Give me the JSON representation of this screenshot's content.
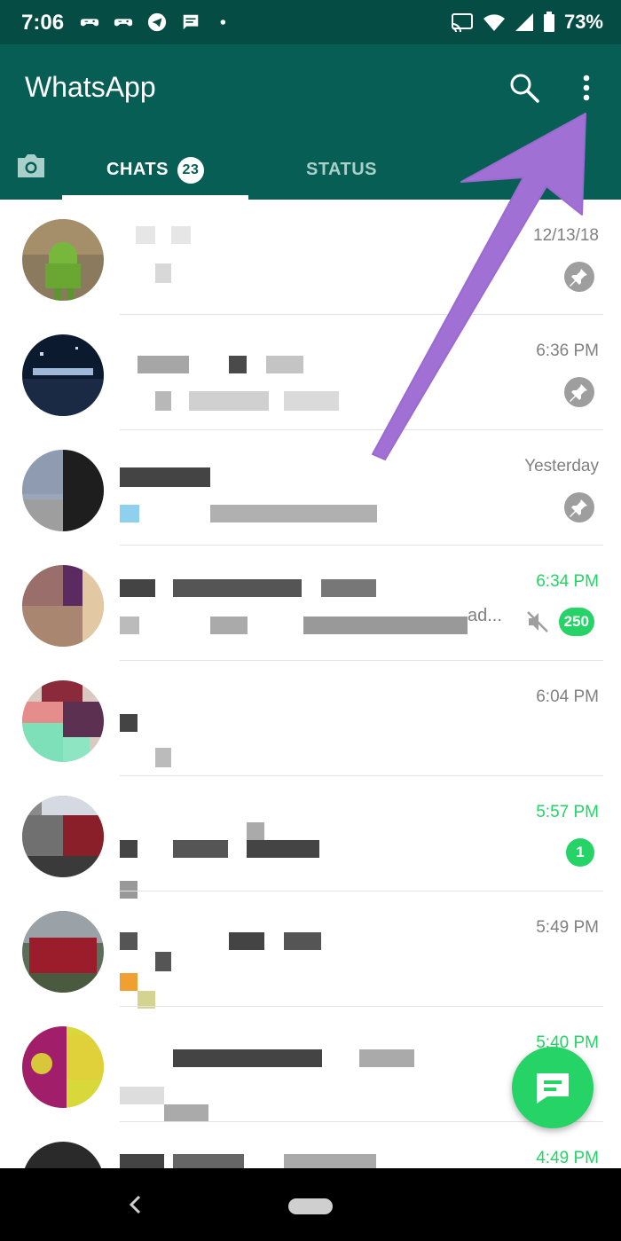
{
  "status_bar": {
    "time": "7:06",
    "battery": "73%",
    "notification_icons": [
      "gamepad-icon",
      "gamepad-icon",
      "telegram-icon",
      "message-icon",
      "dot-icon"
    ],
    "system_icons": [
      "cast-icon",
      "wifi-icon",
      "signal-icon",
      "battery-icon"
    ]
  },
  "app_bar": {
    "title": "WhatsApp",
    "search_icon": "search-icon",
    "more_icon": "more-vert-icon"
  },
  "tabs": {
    "camera_icon": "camera-icon",
    "chats_label": "CHATS",
    "chats_badge": "23",
    "status_label": "STATUS",
    "selected": "CHATS"
  },
  "chats": [
    {
      "time": "12/13/18",
      "pinned": true
    },
    {
      "time": "6:36 PM",
      "pinned": true
    },
    {
      "time": "Yesterday",
      "pinned": true
    },
    {
      "time": "6:34 PM",
      "unread": "250",
      "muted": true,
      "preview_tail": "ad..."
    },
    {
      "time": "6:04 PM"
    },
    {
      "time": "5:57 PM",
      "unread": "1"
    },
    {
      "time": "5:49 PM"
    },
    {
      "time": "5:40 PM"
    },
    {
      "time": "4:49 PM"
    }
  ],
  "fab_icon": "new-chat-icon",
  "nav_bar": {
    "back_icon": "back-icon",
    "home_icon": "home-pill-icon"
  },
  "colors": {
    "header": "#075e54",
    "status_bar": "#054d44",
    "accent_green": "#25d366",
    "annotation_arrow": "#a070d4"
  }
}
